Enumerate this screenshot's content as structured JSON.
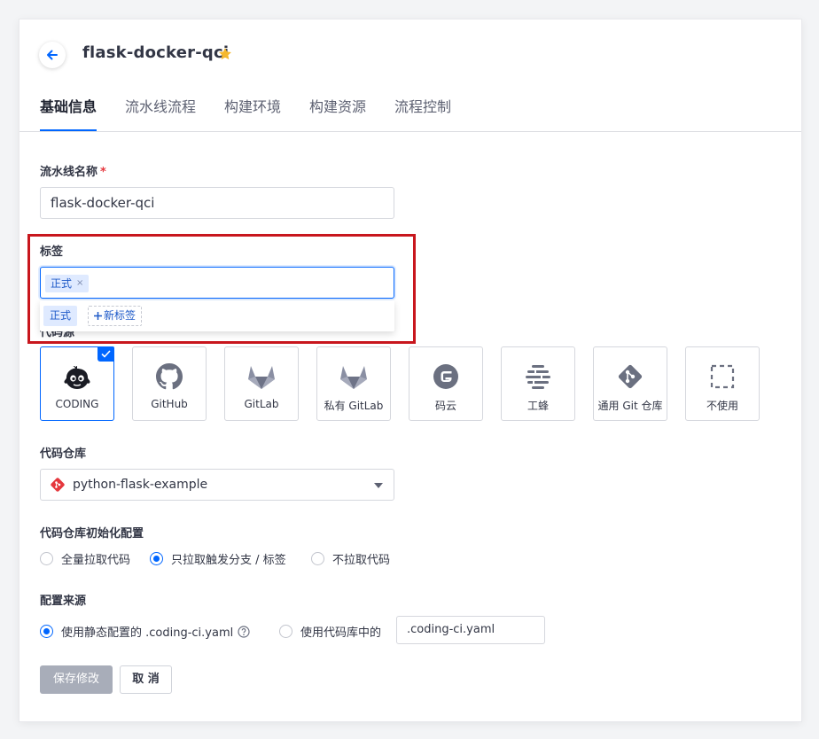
{
  "header": {
    "title": "flask-docker-qci"
  },
  "tabs": [
    {
      "label": "基础信息"
    },
    {
      "label": "流水线流程"
    },
    {
      "label": "构建环境"
    },
    {
      "label": "构建资源"
    },
    {
      "label": "流程控制"
    }
  ],
  "form": {
    "pipeline_name": {
      "label": "流水线名称",
      "required": "*",
      "value": "flask-docker-qci"
    },
    "tags": {
      "label": "标签",
      "selected": [
        "正式"
      ],
      "remove_glyph": "×",
      "options": [
        "正式"
      ],
      "new_tag_label": "新标签"
    },
    "code_source": {
      "label": "代码源",
      "selected": "CODING",
      "options": [
        {
          "name": "CODING",
          "icon": "coding-icon"
        },
        {
          "name": "GitHub",
          "icon": "github-icon"
        },
        {
          "name": "GitLab",
          "icon": "gitlab-icon"
        },
        {
          "name": "私有 GitLab",
          "icon": "private-gitlab-icon"
        },
        {
          "name": "码云",
          "icon": "gitee-icon"
        },
        {
          "name": "工蜂",
          "icon": "tgit-icon"
        },
        {
          "name": "通用 Git 仓库",
          "icon": "git-icon"
        },
        {
          "name": "不使用",
          "icon": "none-icon"
        }
      ]
    },
    "repo": {
      "label": "代码仓库",
      "value": "python-flask-example"
    },
    "init_config": {
      "label": "代码仓库初始化配置",
      "options": [
        "全量拉取代码",
        "只拉取触发分支 / 标签",
        "不拉取代码"
      ],
      "selected_index": 1
    },
    "config_source": {
      "label": "配置来源",
      "options": [
        "使用静态配置的 .coding-ci.yaml",
        "使用代码库中的"
      ],
      "selected_index": 0,
      "repo_file_value": ".coding-ci.yaml"
    }
  },
  "actions": {
    "save_label": "保存修改",
    "cancel_label": "取 消"
  },
  "colors": {
    "primary": "#0066ff",
    "highlight": "#c8161d",
    "star": "#f5b82e",
    "coding_red": "#e5373d"
  }
}
